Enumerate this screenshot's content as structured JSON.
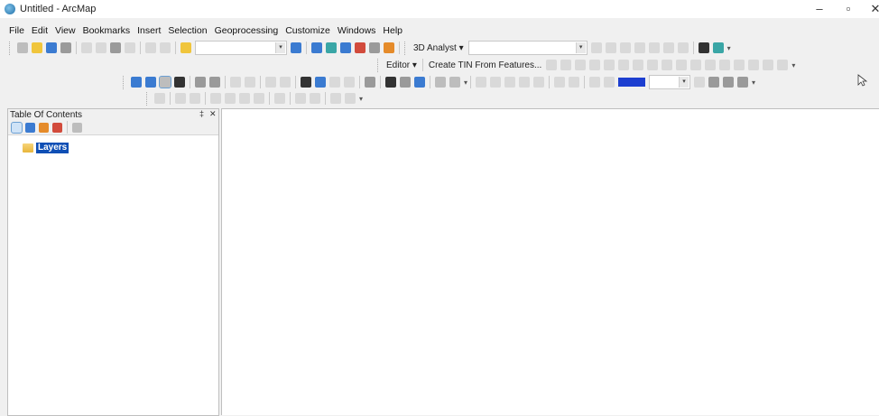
{
  "window": {
    "title": "Untitled - ArcMap",
    "minimize_glyph": "–",
    "maximize_glyph": "▫",
    "close_glyph": "✕"
  },
  "menubar": {
    "items": [
      "File",
      "Edit",
      "View",
      "Bookmarks",
      "Insert",
      "Selection",
      "Geoprocessing",
      "Customize",
      "Windows",
      "Help"
    ]
  },
  "toolbar": {
    "analyst_label": "3D Analyst ▾",
    "editor_label": "Editor ▾",
    "create_tin_label": "Create TIN From Features..."
  },
  "toc": {
    "title": "Table Of Contents",
    "pin_glyph": "‡",
    "close_glyph": "✕",
    "root_layer": "Layers"
  },
  "colors": {
    "selection": "#0f4fb5",
    "accent_blue": "#3b7bd1"
  },
  "icons": [
    "arcmap-app-icon",
    "new-doc-icon",
    "open-icon",
    "save-icon",
    "print-icon",
    "cut-icon",
    "copy-icon",
    "paste-icon",
    "delete-icon",
    "undo-icon",
    "redo-icon",
    "add-data-icon",
    "zoom-in-icon",
    "zoom-out-icon",
    "pan-icon",
    "full-extent-icon",
    "identify-icon",
    "find-icon",
    "measure-icon",
    "layers-folder-icon",
    "mouse-cursor-icon"
  ]
}
